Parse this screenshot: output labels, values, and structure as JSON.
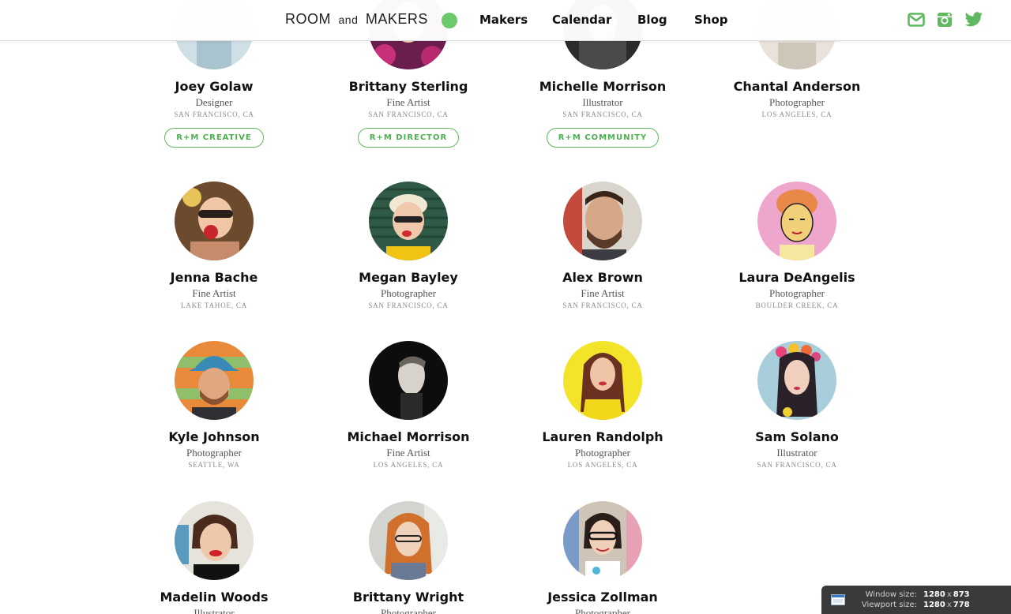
{
  "brand": {
    "left": "ROOM",
    "mid": "and",
    "right": "MAKERS",
    "dot_color": "#6cc96c"
  },
  "nav": [
    {
      "label": "Makers",
      "id": "makers"
    },
    {
      "label": "Calendar",
      "id": "calendar"
    },
    {
      "label": "Blog",
      "id": "blog"
    },
    {
      "label": "Shop",
      "id": "shop"
    }
  ],
  "social": [
    {
      "icon": "mail-icon"
    },
    {
      "icon": "instagram-icon"
    },
    {
      "icon": "twitter-icon"
    }
  ],
  "accent_color": "#5fb85f",
  "makers": [
    {
      "name": "Joey Golaw",
      "role": "Designer",
      "location": "SAN FRANCISCO, CA",
      "badge": "R+M CREATIVE",
      "avatar_color": "#c8d6dc"
    },
    {
      "name": "Brittany Sterling",
      "role": "Fine Artist",
      "location": "SAN FRANCISCO, CA",
      "badge": "R+M DIRECTOR",
      "avatar_color": "#a0286a"
    },
    {
      "name": "Michelle Morrison",
      "role": "Illustrator",
      "location": "SAN FRANCISCO, CA",
      "badge": "R+M COMMUNITY",
      "avatar_color": "#3a3a3a"
    },
    {
      "name": "Chantal Anderson",
      "role": "Photographer",
      "location": "LOS ANGELES, CA",
      "badge": "",
      "avatar_color": "#d9cfc3"
    },
    {
      "name": "Jenna Bache",
      "role": "Fine Artist",
      "location": "LAKE TAHOE, CA",
      "badge": "",
      "avatar_color": "#8a5a3a"
    },
    {
      "name": "Megan Bayley",
      "role": "Photographer",
      "location": "SAN FRANCISCO, CA",
      "badge": "",
      "avatar_color": "#3f6c52"
    },
    {
      "name": "Alex Brown",
      "role": "Fine Artist",
      "location": "SAN FRANCISCO, CA",
      "badge": "",
      "avatar_color": "#b08a76"
    },
    {
      "name": "Laura DeAngelis",
      "role": "Photographer",
      "location": "BOULDER CREEK, CA",
      "badge": "",
      "avatar_color": "#e6a0c8"
    },
    {
      "name": "Kyle Johnson",
      "role": "Photographer",
      "location": "SEATTLE, WA",
      "badge": "",
      "avatar_color": "#e88a3c"
    },
    {
      "name": "Michael Morrison",
      "role": "Fine Artist",
      "location": "LOS ANGELES, CA",
      "badge": "",
      "avatar_color": "#1a1a1a"
    },
    {
      "name": "Lauren Randolph",
      "role": "Photographer",
      "location": "LOS ANGELES, CA",
      "badge": "",
      "avatar_color": "#f2e024"
    },
    {
      "name": "Sam Solano",
      "role": "Illustrator",
      "location": "SAN FRANCISCO, CA",
      "badge": "",
      "avatar_color": "#9ec9d6"
    },
    {
      "name": "Madelin Woods",
      "role": "Illustrator",
      "location": "",
      "badge": "",
      "avatar_color": "#c9b8a8"
    },
    {
      "name": "Brittany Wright",
      "role": "Photographer",
      "location": "",
      "badge": "",
      "avatar_color": "#c0763a"
    },
    {
      "name": "Jessica Zollman",
      "role": "Photographer",
      "location": "",
      "badge": "",
      "avatar_color": "#d2c8be"
    }
  ],
  "window_info": {
    "window_label": "Window size:",
    "window_w": "1280",
    "window_h": "873",
    "viewport_label": "Viewport size:",
    "viewport_w": "1280",
    "viewport_h": "778",
    "x": "x"
  }
}
